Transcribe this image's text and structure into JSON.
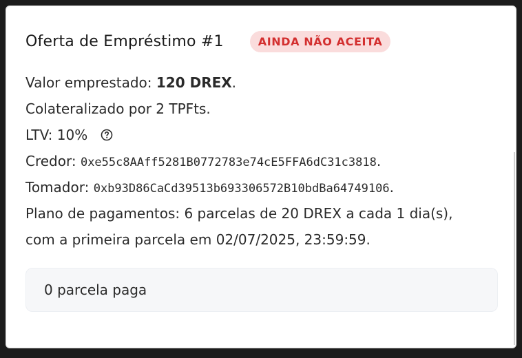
{
  "offer": {
    "title": "Oferta de Empréstimo #1",
    "status_badge": "AINDA NÃO ACEITA",
    "status_color": "#d32f2f",
    "status_bg": "#fadcdc",
    "amount_label": "Valor emprestado:",
    "amount_value": "120 DREX",
    "amount_suffix": ".",
    "collateral_text": "Colateralizado por 2 TPFts.",
    "ltv_label": "LTV: 10%",
    "ltv_help_icon": "question-circle-icon",
    "creditor_label": "Credor:",
    "creditor_address": "0xe55c8AAff5281B0772783e74cE5FFA6dC31c3818",
    "creditor_suffix": ".",
    "borrower_label": "Tomador:",
    "borrower_address": "0xb93D86CaCd39513b693306572B10bdBa64749106",
    "borrower_suffix": ".",
    "plan_line1": "Plano de pagamentos: 6 parcelas de 20 DREX a cada 1 dia(s),",
    "plan_line2": "com a primeira parcela em 02/07/2025, 23:59:59.",
    "paid_installments": "0 parcela paga"
  }
}
